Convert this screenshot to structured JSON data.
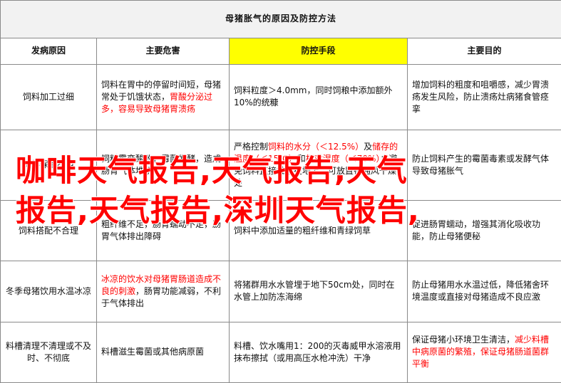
{
  "title": "母猪胀气的原因及防控方法",
  "headers": [
    "发病原因",
    "主要危害",
    "防控手段",
    "主要目的"
  ],
  "rows": [
    {
      "cause": "饲料加工过细",
      "harm": [
        {
          "t": "饲料在胃中的停留时间短，母猪常处于饥饿状态，",
          "red": false
        },
        {
          "t": "胃酸分泌过多，容易导致母猪胃溃疡",
          "red": true
        }
      ],
      "control": [
        {
          "t": "饲料粒度＞4.0mm，同时饲粮中添加额外10%的统糠",
          "red": false
        }
      ],
      "goal": [
        {
          "t": "增加饲料的粗度和咀嚼感，减少胃溃疡发生风险，防止溃疡灶病猪食管痉挛",
          "red": false
        }
      ]
    },
    {
      "cause": "饲料保管不当",
      "harm": [
        {
          "t": "饲料霉变酸败，霉菌发酵，造成肠胃气体堆积",
          "red": false
        }
      ],
      "control": [
        {
          "t": "严格控制",
          "red": false
        },
        {
          "t": "饲料的水分（＜12.5%）",
          "red": true
        },
        {
          "t": "及",
          "red": false
        },
        {
          "t": "储存的温度（＜15℃）",
          "red": true
        },
        {
          "t": "和",
          "red": false
        },
        {
          "t": "相对湿度（＜70%）",
          "red": true
        },
        {
          "t": "；避免饲料直接堆放在地上，可放置在通风干燥处",
          "red": false
        }
      ],
      "goal": [
        {
          "t": "防止饲料产生的霉菌毒素或发酵气体导致母猪胀气",
          "red": false
        }
      ]
    },
    {
      "cause": "饲料搭配不合理",
      "harm": [
        {
          "t": "粗纤维不足，肠胃蠕动不足，肠胃气体排出障碍",
          "red": false
        }
      ],
      "control": [
        {
          "t": "饲料中添加适量的粗纤维和青绿饲草",
          "red": false
        }
      ],
      "goal": [
        {
          "t": "促进肠胃蠕动，增强其消化吸收功能，防止母猪便秘",
          "red": false
        }
      ]
    },
    {
      "cause": "冬季母猪饮用水温冰凉",
      "harm": [
        {
          "t": "冰凉的饮水对母猪胃肠道造成不良的刺激",
          "red": true
        },
        {
          "t": "，肠胃功能减弱，不利于气体排出",
          "red": false
        }
      ],
      "control": [
        {
          "t": "将猪群用水水管埋于地下50cm处，同时在水管上加防冻海绵",
          "red": false
        }
      ],
      "goal": [
        {
          "t": "防止母猪用水水温过低，降低猪舍环境温度或直接对母猪造成不良应激",
          "red": false
        }
      ]
    },
    {
      "cause": "料槽清理不清理或不及时、不彻底",
      "harm": [
        {
          "t": "料槽滋生霉菌或其他病原菌",
          "red": false
        }
      ],
      "control": [
        {
          "t": "料槽、饮水嘴用1：200的灭毒威甲水溶液用抹布擦拭（或用高压水枪冲洗）干净",
          "red": false
        }
      ],
      "goal": [
        {
          "t": "保证母猪小环境卫生清洁，",
          "red": false
        },
        {
          "t": "减少料槽中病原菌的繁殖，保证母猪肠道菌群平衡",
          "red": true
        }
      ]
    }
  ],
  "watermark": {
    "line1": "咖啡天气报告,天气报告,天气",
    "line2": "报告,天气报告,深圳天气报告,"
  },
  "colors": {
    "highlight": "#ffff00",
    "warning_text": "#ff0000",
    "border": "#8a8a8a",
    "title_bg": "#f2f2f2"
  }
}
